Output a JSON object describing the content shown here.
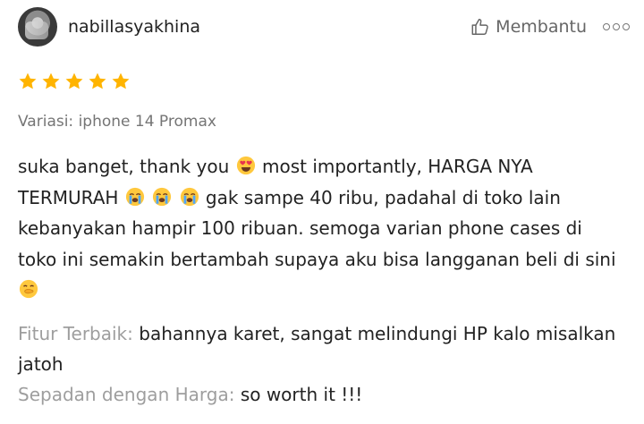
{
  "reviewer": {
    "username": "nabillasyakhina",
    "avatar_icon": "profile-photo"
  },
  "actions": {
    "helpful_label": "Membantu",
    "helpful_icon": "thumbs-up-icon",
    "more_icon": "more-options-icon"
  },
  "rating": {
    "value": 5,
    "max": 5,
    "star_color": "#FFB400"
  },
  "variant": {
    "text": "Variasi: iphone 14 Promax"
  },
  "review": {
    "text_1": "suka banget, thank you",
    "emoji_1": "heart-eyes-emoji",
    "text_2": "most importantly, HARGA NYA TERMURAH",
    "emoji_2": "crying-face-emoji",
    "text_3": "gak sampe 40 ribu, padahal di toko lain kebanyakan hampir 100 ribuan. semoga varian phone cases di toko ini semakin bertambah supaya aku bisa langganan beli di sini",
    "emoji_3": "hand-over-mouth-emoji"
  },
  "attributes": {
    "best_feature_label": "Fitur Terbaik:",
    "best_feature_value": "bahannya karet, sangat melindungi HP kalo misalkan jatoh",
    "value_for_money_label": "Sepadan dengan Harga:",
    "value_for_money_value": "so worth it !!!"
  }
}
